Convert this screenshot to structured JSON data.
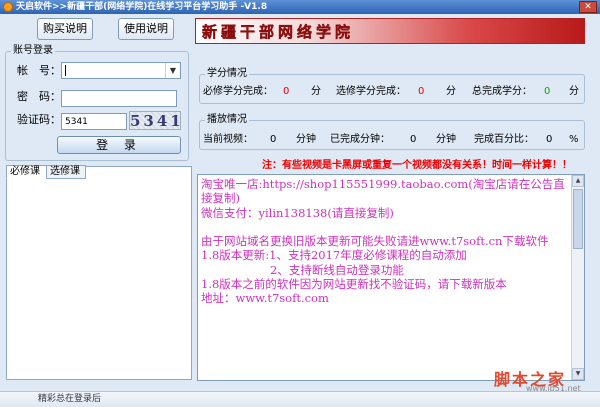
{
  "window": {
    "title": "天启软件>>新疆干部(网络学院)在线学习平台学习助手 -V1.8",
    "close_glyph": "✕"
  },
  "toolbar": {
    "purchase_label": "购买说明",
    "usage_label": "使用说明"
  },
  "banner": {
    "text": "新疆干部网络学院"
  },
  "login": {
    "group_label": "账号登录",
    "account_label": "帐　号：",
    "account_value": "",
    "password_label": "密　码：",
    "password_value": "",
    "captcha_label": "验证码：",
    "captcha_value": "5341",
    "captcha_image_text": "5341",
    "submit_label": "登 录"
  },
  "tabs": [
    {
      "label": "必修课",
      "active": true
    },
    {
      "label": "选修课",
      "active": false
    }
  ],
  "credits": {
    "group_label": "学分情况",
    "required_label": "必修学分完成：",
    "required_value": "0",
    "elective_label": "选修学分完成：",
    "elective_value": "0",
    "total_label": "总完成学分：",
    "total_value": "0",
    "unit": "分"
  },
  "playback": {
    "group_label": "播放情况",
    "current_label": "当前视频：",
    "current_value": "0",
    "done_label": "已完成分钟：",
    "done_value": "0",
    "percent_label": "完成百分比：",
    "percent_value": "0",
    "unit_minutes": "分钟",
    "unit_percent": "%"
  },
  "notice": "注：有些视频是卡黑屏或重复一个视频都没有关系！时间一样计算！！",
  "memo": {
    "text": "淘宝唯一店:https://shop115551999.taobao.com(淘宝店请在公告直接复制)\n微信支付：yilin138138(请直接复制)\n\n由于网站域名更换旧版本更新可能失败请进www.t7soft.cn下载软件\n1.8版本更新:1、支持2017年度必修课程的自动添加\n　　　　　　2、支持断线自动登录功能\n1.8版本之前的软件因为网站更新找不验证码，请下载新版本\n地址：www.t7soft.com"
  },
  "status": {
    "text": "精彩总在登录后"
  },
  "watermark": {
    "text": "脚本之家",
    "url": "www.jb51.net"
  },
  "colors": {
    "memo_text": "#cc33bb",
    "notice": "#ee0000",
    "value_red": "#ee0000",
    "value_green": "#00aa00"
  }
}
